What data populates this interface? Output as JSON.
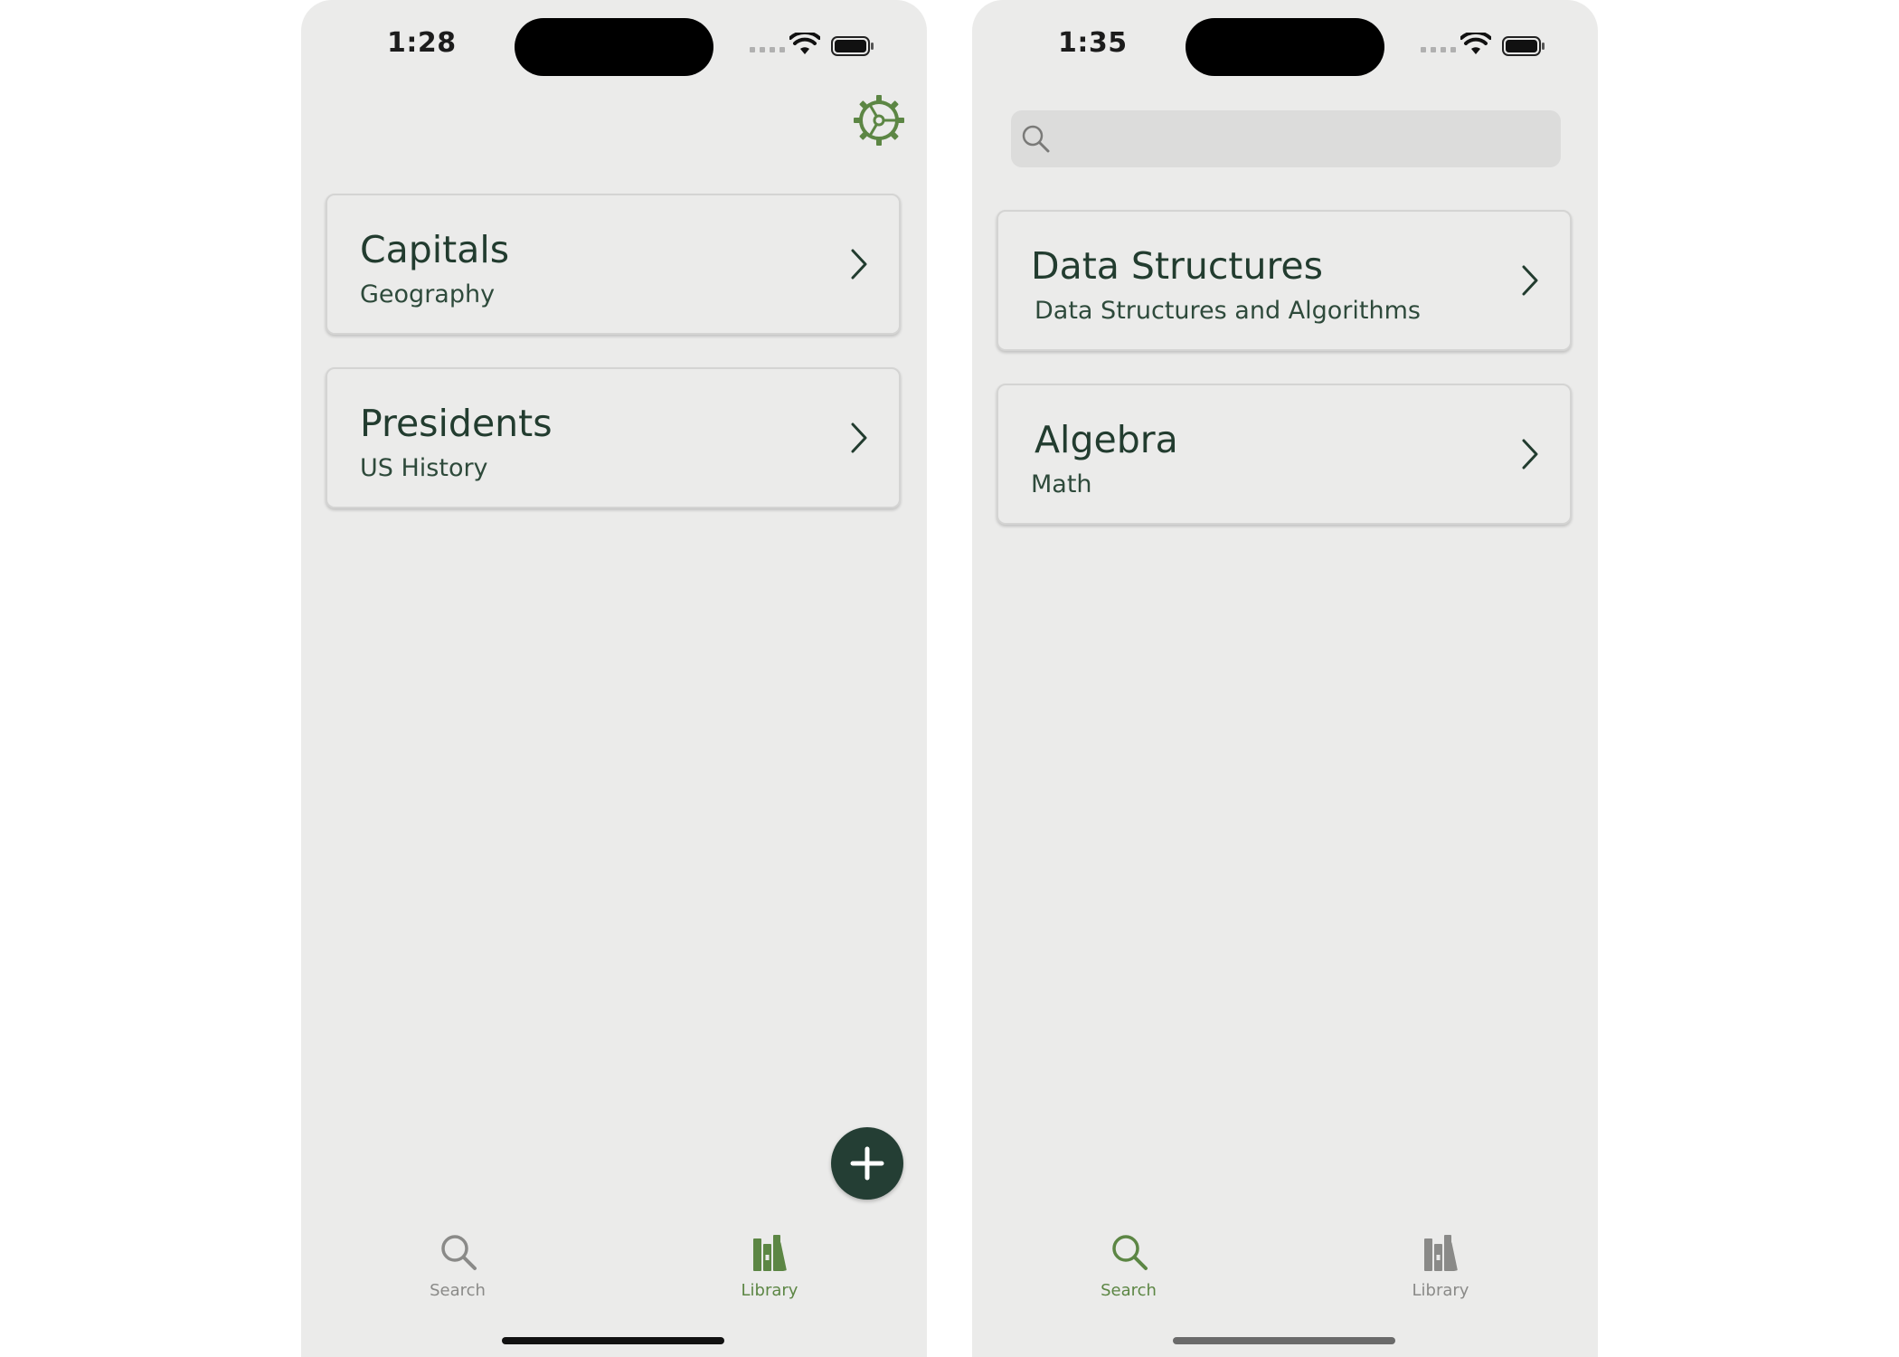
{
  "colors": {
    "screen_bg": "#ebebea",
    "title_text": "#223c2f",
    "accent_green": "#5c8644",
    "fab_bg": "#243e34",
    "inactive_gray": "#8a8a88"
  },
  "screens": [
    {
      "status": {
        "time": "1:28"
      },
      "header": {
        "right_icon": "gear-icon"
      },
      "cards": [
        {
          "title": "Capitals",
          "subtitle": "Geography"
        },
        {
          "title": "Presidents",
          "subtitle": "US History"
        }
      ],
      "fab": {
        "icon": "plus-icon"
      },
      "tabs": [
        {
          "label": "Search",
          "icon": "search-icon",
          "active": false
        },
        {
          "label": "Library",
          "icon": "books-icon",
          "active": true
        }
      ]
    },
    {
      "status": {
        "time": "1:35"
      },
      "search": {
        "value": "",
        "icon": "search-icon"
      },
      "cards": [
        {
          "title": "Data Structures",
          "subtitle": "Data Structures and Algorithms"
        },
        {
          "title": "Algebra",
          "subtitle": "Math"
        }
      ],
      "tabs": [
        {
          "label": "Search",
          "icon": "search-icon",
          "active": true
        },
        {
          "label": "Library",
          "icon": "books-icon",
          "active": false
        }
      ]
    }
  ]
}
